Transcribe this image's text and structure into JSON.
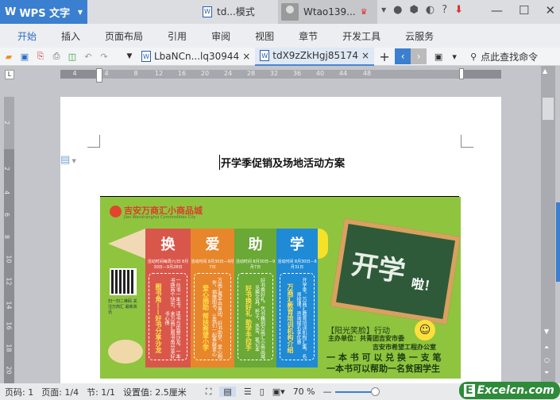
{
  "app": {
    "name": "WPS 文字",
    "doc_tab_title": "td...模式",
    "user": "Wtao139..."
  },
  "menu": [
    "开始",
    "插入",
    "页面布局",
    "引用",
    "审阅",
    "视图",
    "章节",
    "开发工具",
    "云服务"
  ],
  "doc_tabs": [
    {
      "label": "LbaNCn...lq30944",
      "active": false
    },
    {
      "label": "tdX9zZkHgj85174",
      "active": true
    }
  ],
  "search_label": "点此查找命令",
  "ruler": {
    "h": [
      "4",
      "4",
      "8",
      "12",
      "16",
      "20",
      "24",
      "28",
      "32",
      "36",
      "40",
      "44",
      "48"
    ],
    "v": [
      "2",
      "2",
      "4",
      "6",
      "8",
      "10",
      "12",
      "14",
      "16",
      "18",
      "20"
    ]
  },
  "document": {
    "title": "开学季促销及场地活动方案"
  },
  "poster": {
    "logo": "吉安万商汇小商品城",
    "logo_en": "Jian Wanshanghui Commodities City",
    "bands": [
      {
        "char": "换",
        "color": "#d9574a",
        "date": "活动时间每周六/日 8月30日—9月28日",
        "heading": "图书角——好书分享沙龙",
        "text": "一台书一本书，读书与思想沙龙，一本书换两个快乐，来万商汇图书角分享好书心得"
      },
      {
        "char": "爱",
        "color": "#e8862b",
        "date": "活动时间 8月30日—9月7日",
        "heading": "爱心捐助 帮扶希望小学",
        "text": "万商汇携手共青团，好书助梦，爱心相伴，捐赠图书，让我们一起奉献爱心"
      },
      {
        "char": "助",
        "color": "#6aa935",
        "date": "活动时间 8月30日—9月7日",
        "heading": "好书换好礼 助学手拉手",
        "text": "好书换好礼，凭书籍到万商汇小商品城兑换文具，杯子，水壶，笔记本"
      },
      {
        "char": "学",
        "color": "#1f8ad6",
        "date": "活动时间 8月30日—8月31日",
        "heading": "万商汇教育培训机构介绍",
        "text": "开学季，万商汇教育培训机构汇集，名师授课，咨询报名享优惠"
      }
    ],
    "qr_caption": "扫一扫二维码 关注万商汇 最新资讯",
    "board_text": "开学",
    "board_exclaim": "啦！",
    "campaign": "【阳光笑脸】行动",
    "organizer_1": "主办单位：共青团吉安市委",
    "organizer_2": "吉安市希望工程办公室",
    "slogan_1": "一 本 书 可 以 兑 换 一 支 笔",
    "slogan_2": "一本书可以帮助一名贫困学生"
  },
  "status": {
    "page": "页码: 1",
    "pages": "页面: 1/4",
    "section": "节: 1/1",
    "setting": "设置值: 2.5厘米",
    "zoom": "70 %",
    "zoom_percent": 70
  },
  "watermark": "Excelcn.com"
}
